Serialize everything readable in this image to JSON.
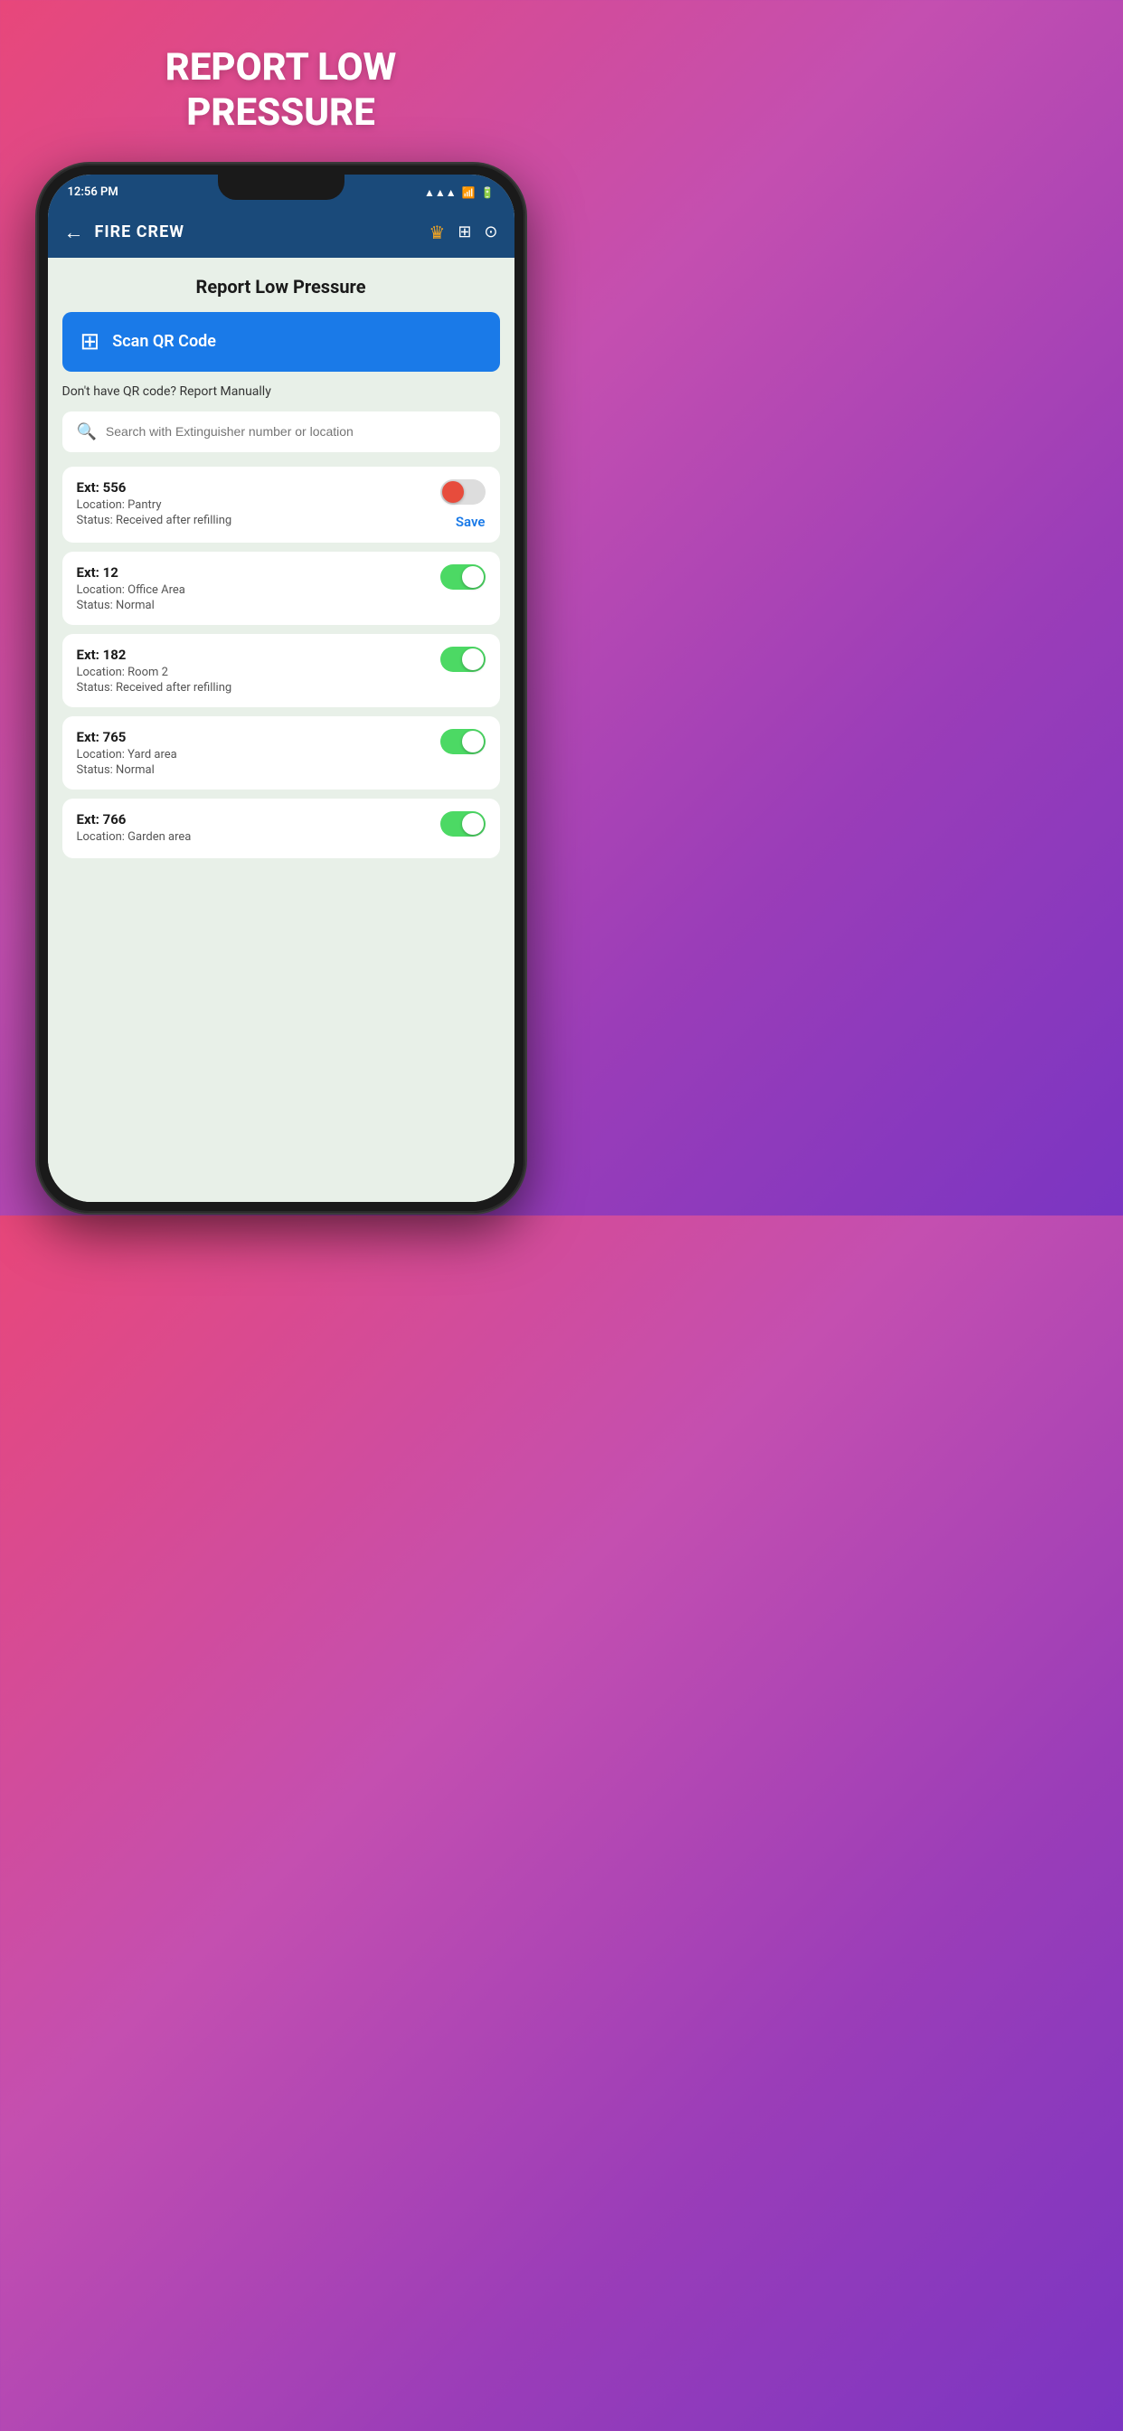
{
  "headline": {
    "line1": "REPORT LOW",
    "line2": "PRESSURE"
  },
  "statusBar": {
    "time": "12:56 PM",
    "battery": "0.3",
    "signal": "▲▲▲",
    "wifi": "WiFi",
    "batteryIcon": "25"
  },
  "navBar": {
    "backIcon": "←",
    "title": "FIRE CREW",
    "crownIcon": "♛",
    "qrIcon": "⊞",
    "headsetIcon": "🎧"
  },
  "page": {
    "title": "Report Low Pressure",
    "scanButton": "Scan QR Code",
    "manualText": "Don't have QR code? Report Manually",
    "searchPlaceholder": "Search with Extinguisher number or location",
    "saveLabel": "Save"
  },
  "extinguishers": [
    {
      "id": "ext-556",
      "number": "Ext: 556",
      "location": "Location: Pantry",
      "status": "Status: Received after refilling",
      "toggleState": "partial",
      "showSave": true
    },
    {
      "id": "ext-12",
      "number": "Ext: 12",
      "location": "Location: Office Area",
      "status": "Status: Normal",
      "toggleState": "on",
      "showSave": false
    },
    {
      "id": "ext-182",
      "number": "Ext: 182",
      "location": "Location: Room 2",
      "status": "Status: Received after refilling",
      "toggleState": "on",
      "showSave": false
    },
    {
      "id": "ext-765",
      "number": "Ext: 765",
      "location": "Location: Yard area",
      "status": "Status: Normal",
      "toggleState": "on",
      "showSave": false
    },
    {
      "id": "ext-766",
      "number": "Ext: 766",
      "location": "Location: Garden area",
      "status": "",
      "toggleState": "on",
      "showSave": false
    }
  ]
}
